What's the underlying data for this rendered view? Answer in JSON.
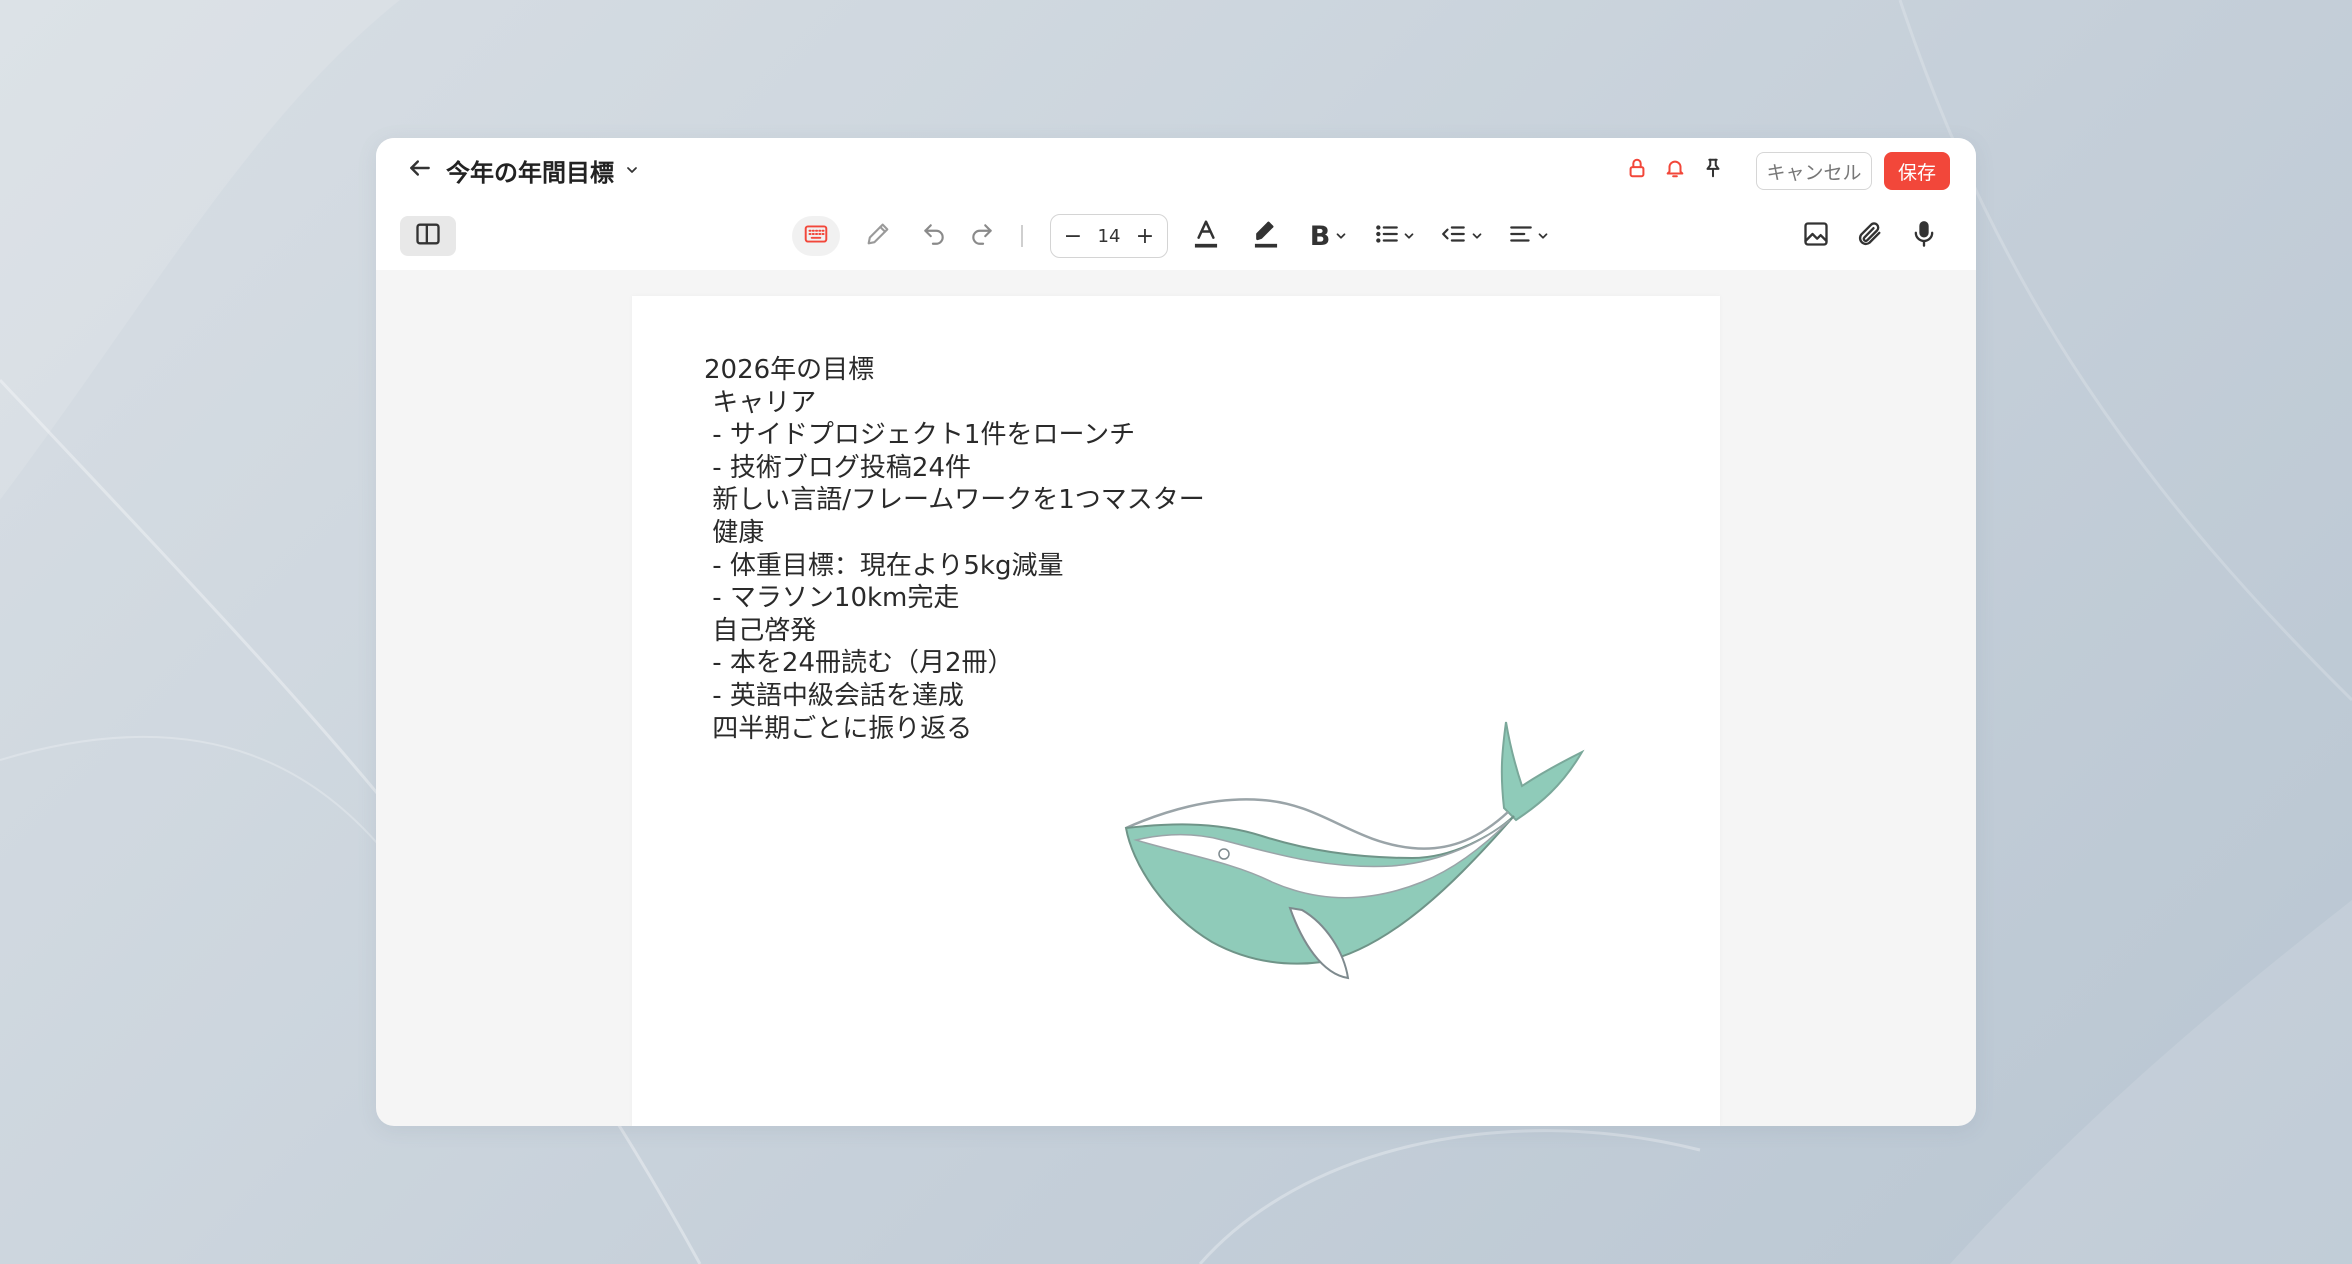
{
  "header": {
    "title": "今年の年間目標",
    "cancel_label": "キャンセル",
    "save_label": "保存"
  },
  "toolbar": {
    "font_size": "14",
    "minus": "−",
    "plus": "+",
    "bold": "B"
  },
  "document": {
    "lines": [
      "2026年の目標",
      " キャリア",
      " - サイドプロジェクト1件をローンチ",
      " - 技術ブログ投稿24件",
      " 新しい言語/フレームワークを1つマスター",
      " 健康",
      " - 体重目標：現在より5kg減量",
      " - マラソン10km完走",
      " 自己啓発",
      " - 本を24冊読む（月2冊）",
      " - 英語中級会話を達成",
      " 四半期ごとに振り返る"
    ]
  },
  "colors": {
    "accent": "#f2473a",
    "whale_fill": "#8fcbb9",
    "icon": "#333333"
  },
  "icons": {
    "back": "arrow-left-icon",
    "lock": "lock-icon",
    "bell": "bell-icon",
    "pin": "pin-icon"
  }
}
